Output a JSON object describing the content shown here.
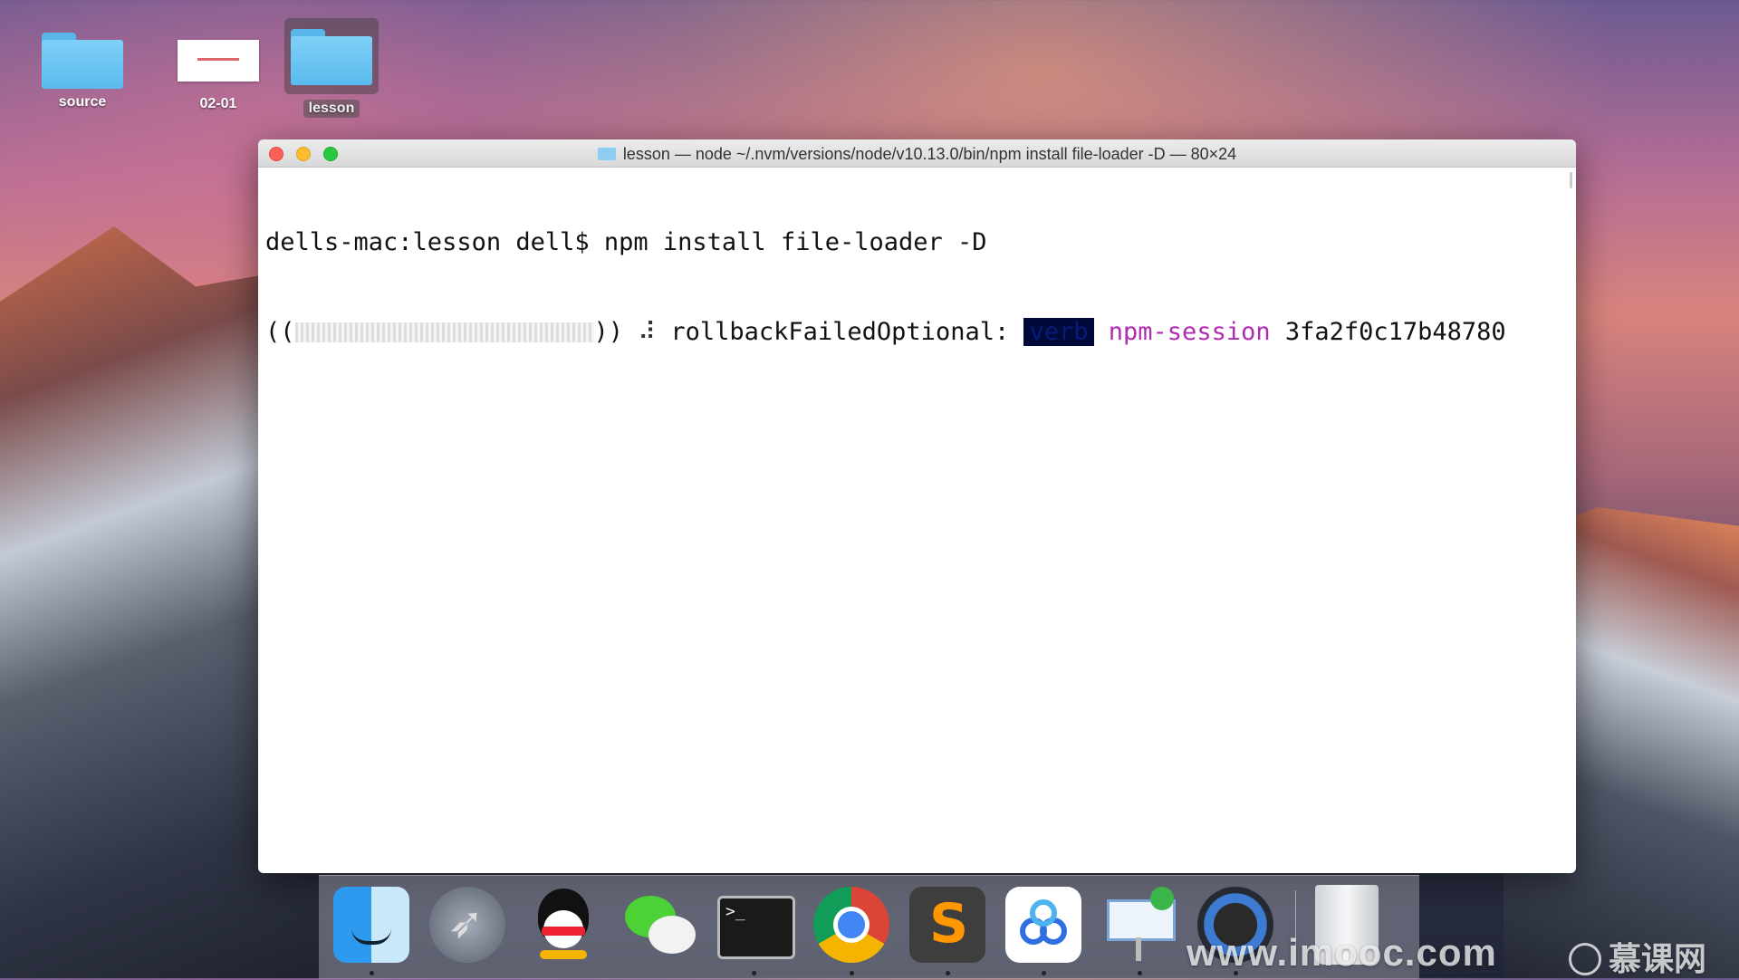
{
  "desktop": {
    "icons": [
      {
        "label": "source",
        "type": "folder"
      },
      {
        "label": "02-01",
        "type": "document"
      },
      {
        "label": "lesson",
        "type": "folder",
        "selected": true
      }
    ]
  },
  "terminal": {
    "title": "lesson — node ~/.nvm/versions/node/v10.13.0/bin/npm install file-loader -D — 80×24",
    "lines": {
      "prompt": "dells-mac:lesson dell$ npm install file-loader -D",
      "progress_open": "((",
      "progress_close": "))",
      "spinner": "⠼",
      "status": "rollbackFailedOptional:",
      "level": "verb",
      "session_label": "npm-session",
      "session_id": "3fa2f0c17b48780"
    }
  },
  "dock": {
    "apps": [
      "finder-icon",
      "launchpad-icon",
      "qq-icon",
      "wechat-icon",
      "terminal-icon",
      "chrome-icon",
      "sublime-text-icon",
      "baidu-netdisk-icon",
      "keynote-icon",
      "quicktime-icon",
      "trash-icon"
    ],
    "terminal_glyph": ">_"
  },
  "watermark": {
    "url": "www.imooc.com",
    "brand": "慕课网"
  },
  "colors": {
    "highlight_bg": "#000a3a",
    "session_color": "#b02bb0",
    "traffic_red": "#fc5f57",
    "traffic_yellow": "#fdbd2e",
    "traffic_green": "#28c840"
  }
}
